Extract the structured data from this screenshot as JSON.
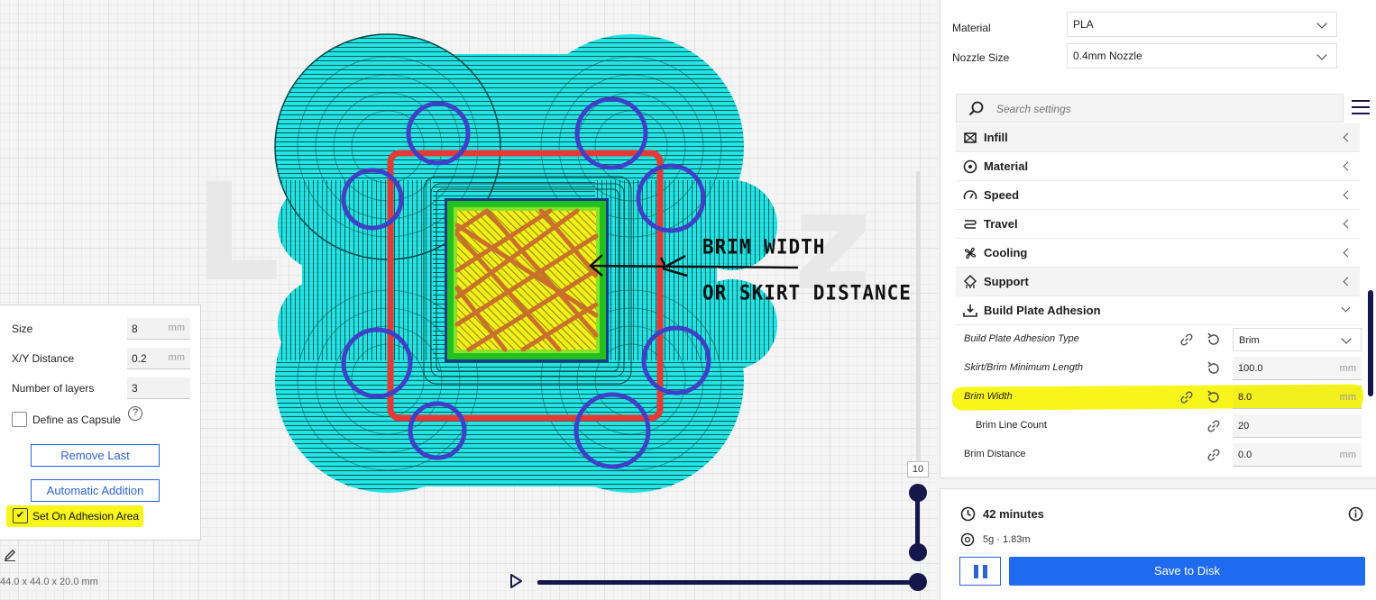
{
  "annotation": {
    "line1": "BRIM WIDTH",
    "line2": "OR SKIRT DISTANCE"
  },
  "layer_slider": {
    "value": "10"
  },
  "tool_panel": {
    "size": {
      "label": "Size",
      "value": "8",
      "unit": "mm"
    },
    "xy_distance": {
      "label": "X/Y Distance",
      "value": "0.2",
      "unit": "mm"
    },
    "layers": {
      "label": "Number of layers",
      "value": "3"
    },
    "capsule": {
      "label": "Define as Capsule",
      "checked": false,
      "help": "?"
    },
    "remove_last": "Remove Last",
    "automatic_addition": "Automatic Addition",
    "adhesion": {
      "label": "Set On Adhesion Area",
      "checked": true,
      "check_mark": "✔"
    }
  },
  "model_dimensions": "44.0 x 44.0 x 20.0 mm",
  "settings": {
    "material": {
      "label": "Material",
      "value": "PLA"
    },
    "nozzle": {
      "label": "Nozzle Size",
      "value": "0.4mm Nozzle"
    },
    "search_placeholder": "Search settings",
    "categories": [
      {
        "label": "Infill",
        "icon": "infill-icon"
      },
      {
        "label": "Material",
        "icon": "material-icon"
      },
      {
        "label": "Speed",
        "icon": "speed-icon"
      },
      {
        "label": "Travel",
        "icon": "travel-icon"
      },
      {
        "label": "Cooling",
        "icon": "fan-icon"
      },
      {
        "label": "Support",
        "icon": "support-icon"
      },
      {
        "label": "Build Plate Adhesion",
        "icon": "adhesion-icon",
        "expanded": true
      }
    ],
    "adhesion_settings": {
      "type": {
        "label": "Build Plate Adhesion Type",
        "value": "Brim"
      },
      "skirt_min_length": {
        "label": "Skirt/Brim Minimum Length",
        "value": "100.0",
        "unit": "mm"
      },
      "brim_width": {
        "label": "Brim Width",
        "value": "8.0",
        "unit": "mm"
      },
      "brim_line_count": {
        "label": "Brim Line Count",
        "value": "20"
      },
      "brim_distance": {
        "label": "Brim Distance",
        "value": "0.0",
        "unit": "mm"
      }
    }
  },
  "action_panel": {
    "print_time": "42 minutes",
    "material_usage": "5g · 1.83m",
    "save_label": "Save to Disk"
  },
  "colors": {
    "brim": "#1fe6e6",
    "skirt_square": "#e53935",
    "tab_circles": "#3f3fc8",
    "accent": "#1f6bef",
    "slider": "#14164c",
    "highlight": "#f7f51a"
  }
}
